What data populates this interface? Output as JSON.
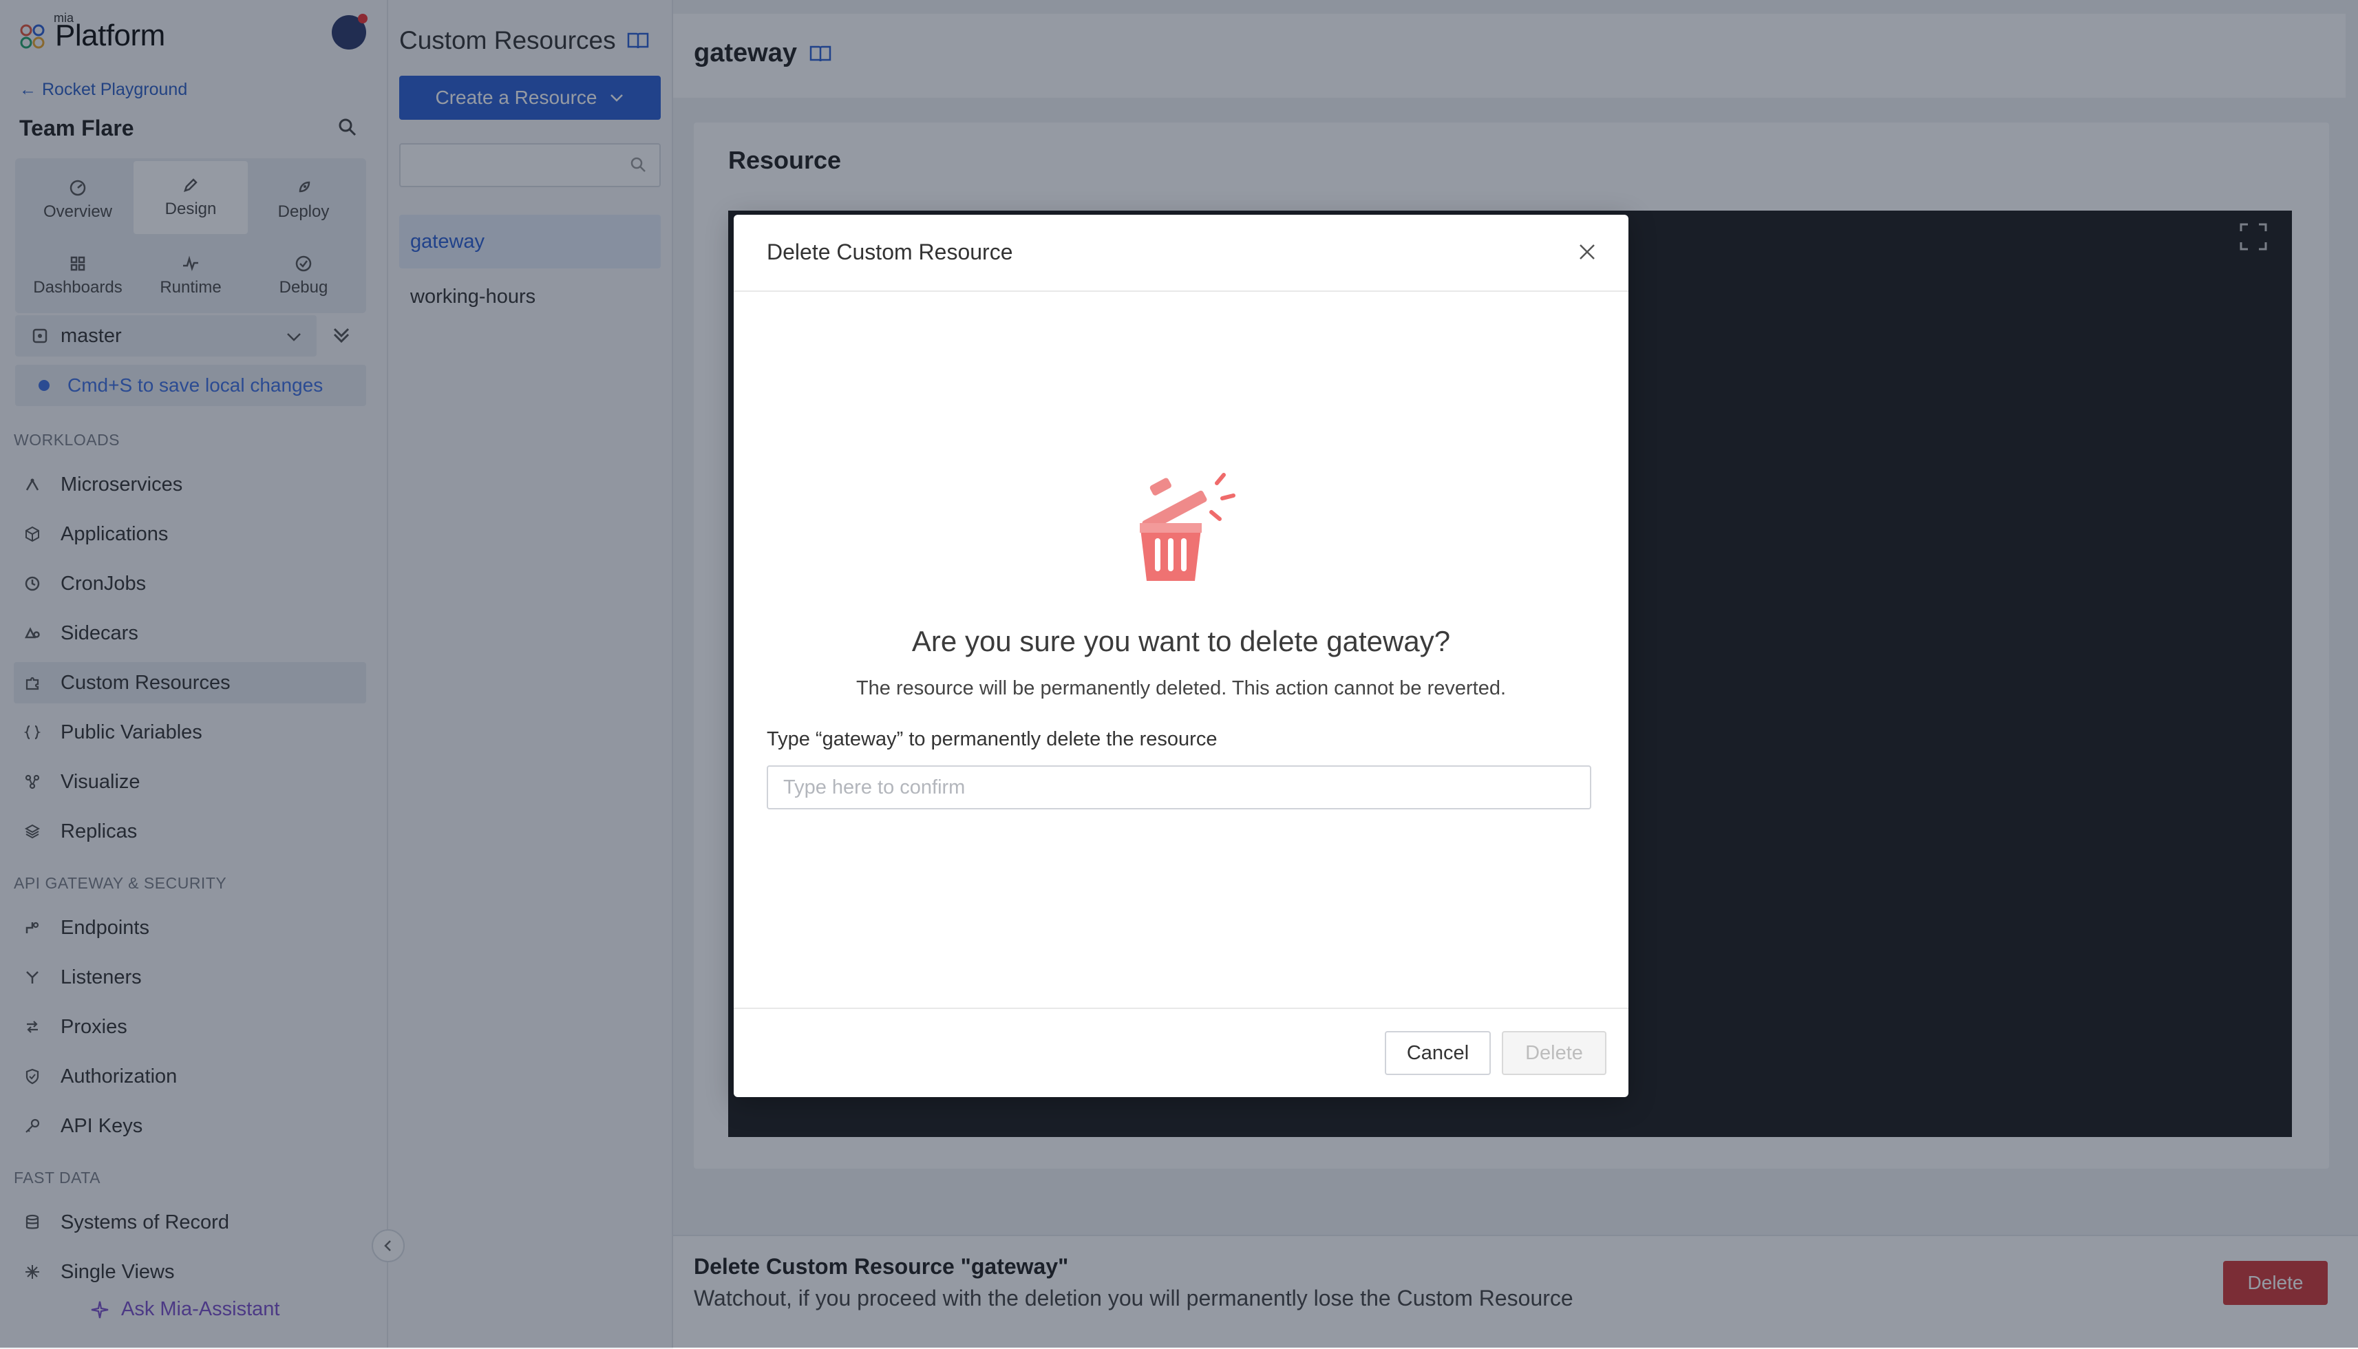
{
  "app": {
    "logo_small": "mia",
    "logo_text": "Platform"
  },
  "sidebar": {
    "back_link": "Rocket Playground",
    "team": "Team Flare",
    "tabs": [
      {
        "label": "Overview",
        "icon": "overview-icon"
      },
      {
        "label": "Design",
        "icon": "pencil-icon",
        "active": true
      },
      {
        "label": "Deploy",
        "icon": "rocket-icon"
      },
      {
        "label": "Dashboards",
        "icon": "dashboard-icon"
      },
      {
        "label": "Runtime",
        "icon": "pulse-icon"
      },
      {
        "label": "Debug",
        "icon": "check-circle-icon"
      }
    ],
    "branch": "master",
    "save_tip": "Cmd+S to save local changes",
    "sections": {
      "workloads": "WORKLOADS",
      "api": "API GATEWAY & SECURITY",
      "fastdata": "FAST DATA"
    },
    "workloads": [
      {
        "label": "Microservices",
        "icon": "microservices-icon"
      },
      {
        "label": "Applications",
        "icon": "cube-icon"
      },
      {
        "label": "CronJobs",
        "icon": "clock-icon"
      },
      {
        "label": "Sidecars",
        "icon": "sidecar-icon"
      },
      {
        "label": "Custom Resources",
        "icon": "puzzle-icon",
        "active": true
      },
      {
        "label": "Public Variables",
        "icon": "braces-icon"
      },
      {
        "label": "Visualize",
        "icon": "graph-icon"
      },
      {
        "label": "Replicas",
        "icon": "layers-icon"
      }
    ],
    "api": [
      {
        "label": "Endpoints",
        "icon": "endpoint-icon"
      },
      {
        "label": "Listeners",
        "icon": "listener-icon"
      },
      {
        "label": "Proxies",
        "icon": "swap-icon"
      },
      {
        "label": "Authorization",
        "icon": "shield-icon"
      },
      {
        "label": "API Keys",
        "icon": "key-icon"
      }
    ],
    "fastdata": [
      {
        "label": "Systems of Record",
        "icon": "database-icon"
      },
      {
        "label": "Single Views",
        "icon": "sparkle-icon"
      }
    ],
    "assistant": "Ask Mia-Assistant"
  },
  "list": {
    "title": "Custom Resources",
    "create_label": "Create a Resource",
    "search_placeholder": "",
    "items": [
      "gateway",
      "working-hours"
    ],
    "selected": "gateway"
  },
  "main": {
    "title": "gateway",
    "card_title": "Resource",
    "footer_title": "Delete Custom Resource \"gateway\"",
    "footer_desc": "Watchout, if you proceed with the deletion you will permanently lose the Custom Resource",
    "footer_delete": "Delete"
  },
  "modal": {
    "title": "Delete Custom Resource",
    "question": "Are you sure you want to delete gateway?",
    "subtitle": "The resource will be permanently deleted. This action cannot be reverted.",
    "type_label": "Type “gateway” to permanently delete the resource",
    "input_placeholder": "Type here to confirm",
    "input_value": "",
    "cancel": "Cancel",
    "delete": "Delete"
  },
  "colors": {
    "primary": "#2d5fd1",
    "danger": "#d03a3a",
    "assistant": "#7b4fc9",
    "trash": "#ef6b6b"
  }
}
